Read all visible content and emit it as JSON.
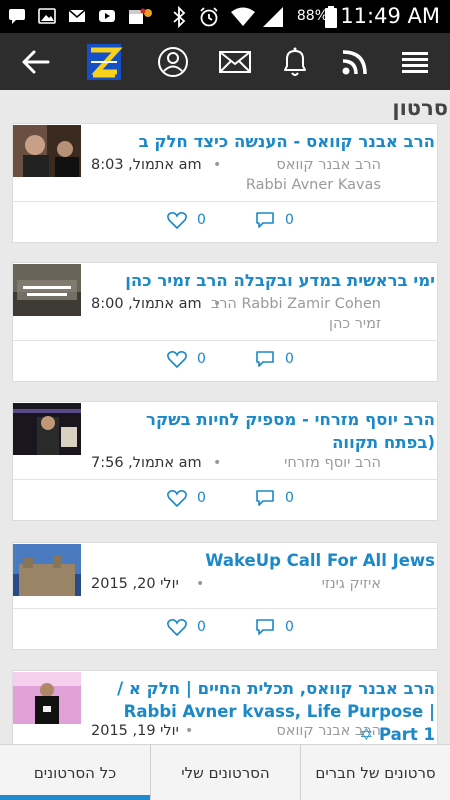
{
  "status_bar": {
    "battery_percent": "88%",
    "time": "11:49 AM",
    "notification_icons": [
      "message-icon",
      "photo-icon",
      "gmail-icon",
      "youtube-icon",
      "calendar-icon"
    ]
  },
  "app_bar": {
    "icons": [
      "back-arrow-icon",
      "app-logo",
      "profile-icon",
      "mail-icon",
      "bell-icon",
      "rss-icon",
      "menu-icon"
    ],
    "accent_color": "#1a88c9"
  },
  "page": {
    "title": "סרטון"
  },
  "videos": [
    {
      "title": "הרב אבנר קוואס - הענשה כיצד חלק ב",
      "author": "הרב אבנר קוואס",
      "author_en": "Rabbi Avner Kavas",
      "date": "אתמול, 8:03 am",
      "likes": "0",
      "comments": "0"
    },
    {
      "title": "ימי בראשית במדע ובקבלה הרב זמיר כהן",
      "author": "Rabbi Zamir Cohen הרב",
      "author_en": "זמיר כהן",
      "date": "אתמול, 8:00 am",
      "likes": "0",
      "comments": "0"
    },
    {
      "title": "הרב יוסף מזרחי - מספיק לחיות בשקר (בפתח תקווה",
      "author": "הרב יוסף מזרחי",
      "author_en": "",
      "date": "אתמול, 7:56 am",
      "likes": "0",
      "comments": "0"
    },
    {
      "title": "WakeUp Call For All Jews",
      "author": "איזיק גינזי",
      "author_en": "",
      "date": "יולי 20, 2015",
      "likes": "0",
      "comments": "0"
    },
    {
      "title": "הרב אבנר קוואס, תכלית החיים | חלק א / Rabbi Avner kvass, Life Purpose | Part 1 ✡",
      "author": "הרב אבנר קוואס",
      "author_en": "",
      "date": "יולי 19, 2015",
      "likes": "",
      "comments": ""
    }
  ],
  "tabs": [
    {
      "label": "כל הסרטונים",
      "active": true
    },
    {
      "label": "הסרטונים שלי",
      "active": false
    },
    {
      "label": "סרטונים של חברים",
      "active": false
    }
  ]
}
